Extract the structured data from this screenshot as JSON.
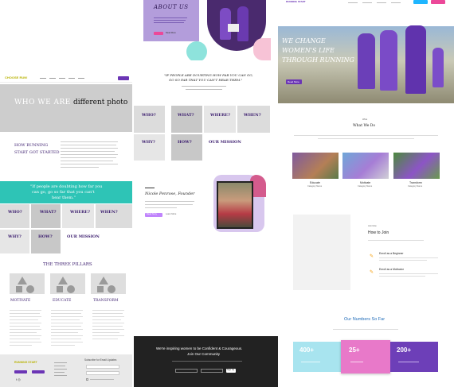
{
  "colors": {
    "purple": "#6b35b5",
    "teal": "#2ec4b6",
    "pink": "#ec4899",
    "dark": "#222222",
    "grey": "#cfcfcf",
    "peach": "#f6c6b8"
  },
  "about": {
    "title": "ABOUT US",
    "button": "Read More"
  },
  "hero_site": {
    "headline1": "WE CHANGE",
    "headline2": "WOMEN'S LIFE",
    "headline3": "THROUGH RUNNING",
    "button": "Read More"
  },
  "quote1": {
    "line1": "\"IF PEOPLE ARE DOUBTING HOW FAR YOU CAN GO,",
    "line2": "GO SO FAR THAT YOU CAN'T HEAR THEM.\""
  },
  "grid1": {
    "c1": "WHO?",
    "c2": "WHAT?",
    "c3": "WHERE?",
    "c4": "WHEN?",
    "c5": "WHY?",
    "c6": "HOW?",
    "c7": "OUR MISSION"
  },
  "logo_strip": {
    "brand": "CHOOSE RUN!"
  },
  "banner": {
    "left": "WHO WE ARE",
    "right": "different photo"
  },
  "how": {
    "title_line1": "HOW RUNNING",
    "title_line2": "START GOT STARTED"
  },
  "whatwedo": {
    "kicker": "What",
    "title": "What We Do",
    "cards": [
      {
        "title": "Educate",
        "sub": "Category Name"
      },
      {
        "title": "Motivate",
        "sub": "Category Name"
      },
      {
        "title": "Transform",
        "sub": "Category Name"
      }
    ]
  },
  "quote2": {
    "line1": "\"If people are doubting how far you",
    "line2": "can go, go so far that you can't",
    "line3": "hear them.\""
  },
  "grid2": {
    "c1": "WHO?",
    "c2": "WHAT?",
    "c3": "WHERE?",
    "c4": "WHEN?",
    "c5": "WHY?",
    "c6": "HOW?",
    "c7": "OUR MISSION"
  },
  "founder": {
    "name": "Nicole Penrose, Founder",
    "btn1": "Read Story",
    "btn2": "Learn More"
  },
  "join": {
    "kicker": "Join Now",
    "title": "How to Join",
    "item1": "Enroll as a Beginner",
    "item2": "Enroll as a Motivator"
  },
  "pillars": {
    "title": "THE THREE PILLARS",
    "items": [
      "MOTIVATE",
      "EDUCATE",
      "TRANSFORM"
    ]
  },
  "numbers": {
    "title": "Our Numbers So Far",
    "stats": [
      {
        "value": "400+",
        "color": "#a8e4ef"
      },
      {
        "value": "25+",
        "color": "#e879c9"
      },
      {
        "value": "200+",
        "color": "#6d3fb8"
      }
    ]
  },
  "footer_form": {
    "line1": "We're inspiring women to be Confident & Courageous.",
    "line2": "Join Our Community",
    "button": "Sign Up"
  },
  "footer_left": {
    "brand": "RUNNING START",
    "title": "Subscribe for Email Updates"
  }
}
